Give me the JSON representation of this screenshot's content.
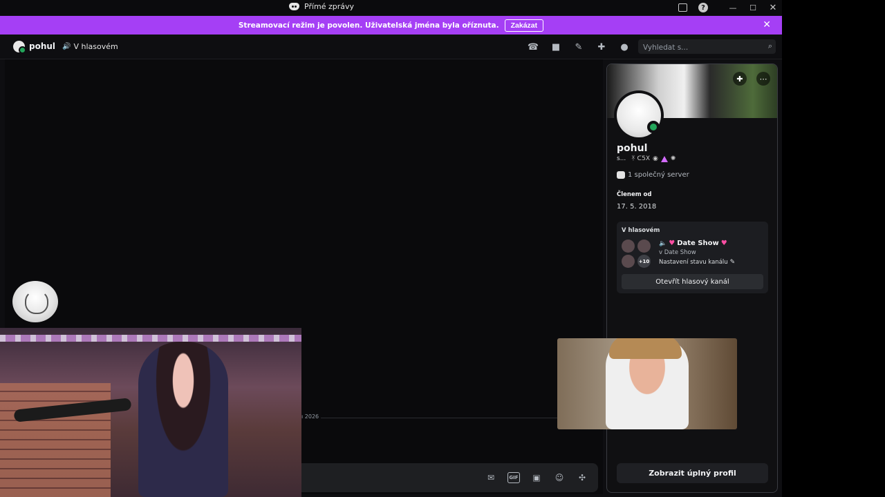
{
  "window": {
    "title": "Přímé zprávy",
    "controls": {
      "minimize": "—",
      "maximize": "☐",
      "close": "✕"
    },
    "icons": {
      "inbox": "inbox-icon",
      "help": "help-icon",
      "help_glyph": "?"
    }
  },
  "banner": {
    "message": "Streamovací režim je povolen. Uživatelská jména byla oříznuta.",
    "button": "Zakázat",
    "close": "✕",
    "color": "#a53ff5"
  },
  "header": {
    "name": "pohul",
    "voice_status": "V hlasovém",
    "search_placeholder": "Vyhledat s...",
    "icons": [
      "phone-call-icon",
      "video-call-icon",
      "pin-icon",
      "add-friend-icon",
      "user-profile-icon",
      "search-icon"
    ]
  },
  "chat": {
    "date_divider": "ı 2026",
    "composer_icons": [
      "gift-icon",
      "gif-icon",
      "sticker-icon",
      "emoji-icon",
      "apps-icon"
    ],
    "gif_label": "GIF"
  },
  "profile": {
    "name": "pohul",
    "pronoun_truncated": "s...",
    "badges_text": "ᛡ ᑕ5Χ",
    "mutual_servers": "1 společný server",
    "member_since_label": "Členem od",
    "member_since_date": "17. 5. 2018",
    "voice": {
      "label": "V hlasovém",
      "channel_name": "Date Show",
      "server": "v Date Show",
      "status_setting": "Nastavení stavu kanálu",
      "more_count": "+10",
      "open_button": "Otevřít hlasový kanál"
    },
    "full_profile_button": "Zobrazit úplný profil",
    "status_color": "#23a55a"
  }
}
